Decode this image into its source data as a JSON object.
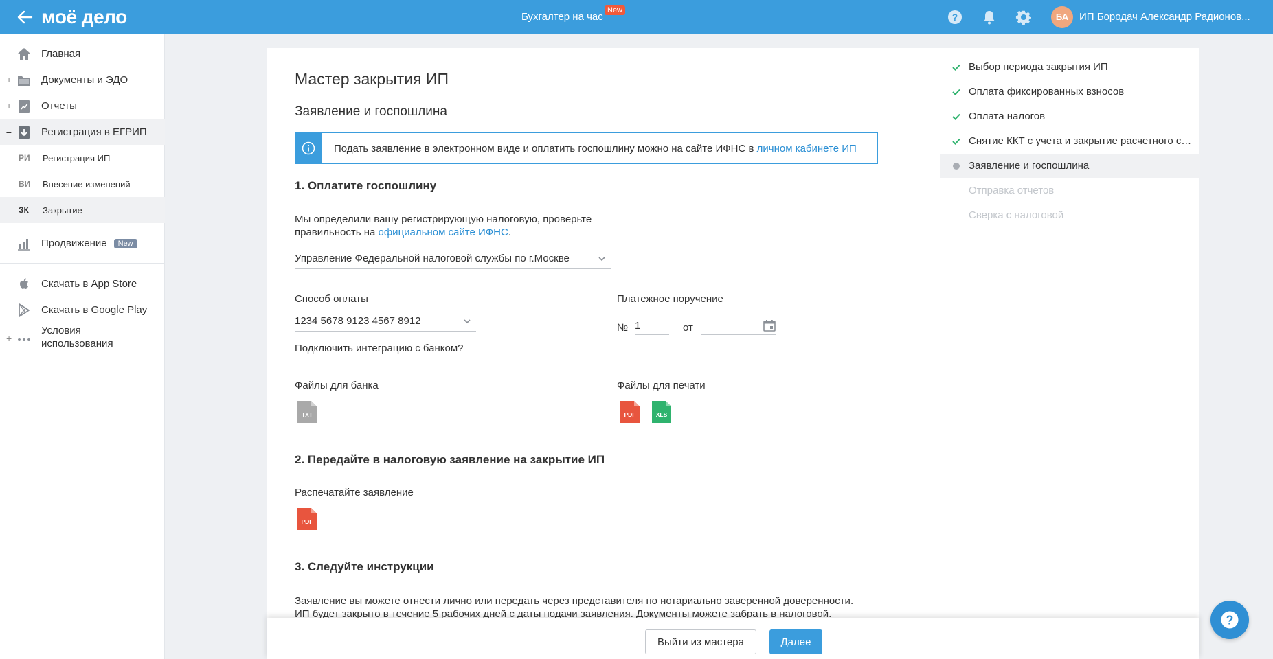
{
  "header": {
    "logo": "моё дело",
    "center_title": "Бухгалтер на час",
    "center_badge": "New",
    "avatar_initials": "БА",
    "user_name": "ИП Бородач Александр Радионов..."
  },
  "sidebar": {
    "items": [
      {
        "label": "Главная",
        "icon": "home-icon"
      },
      {
        "label": "Документы и ЭДО",
        "icon": "folder-icon",
        "prefix": "+"
      },
      {
        "label": "Отчеты",
        "icon": "report-icon",
        "prefix": "+"
      },
      {
        "label": "Регистрация в ЕГРИП",
        "icon": "registration-icon",
        "prefix": "–"
      }
    ],
    "sub_items": [
      {
        "abbr": "РИ",
        "label": "Регистрация ИП"
      },
      {
        "abbr": "ВИ",
        "label": "Внесение изменений"
      },
      {
        "abbr": "ЗК",
        "label": "Закрытие"
      }
    ],
    "promo": {
      "label": "Продвижение",
      "badge": "New"
    },
    "extra": [
      {
        "label": "Скачать в App Store"
      },
      {
        "label": "Скачать в Google Play"
      },
      {
        "label_line1": "Условия",
        "label_line2": "использования",
        "prefix": "+"
      }
    ]
  },
  "main": {
    "title": "Мастер закрытия ИП",
    "subtitle": "Заявление и госпошлина",
    "info_text": "Подать заявление в электронном виде и оплатить госпошлину можно на сайте ИФНС в ",
    "info_link": "личном кабинете ИП",
    "section1": {
      "title": "1. Оплатите госпошлину",
      "desc_line1": "Мы определили вашу регистрирующую налоговую, проверьте",
      "desc_line2_prefix": "правильность на ",
      "desc_link": "официальном сайте ИФНС",
      "desc_line2_suffix": ".",
      "tax_office": "Управление Федеральной налоговой службы по г.Москве",
      "payment_method_label": "Способ оплаты",
      "payment_method_value": "1234 5678 9123 4567 8912",
      "bank_link": "Подключить интеграцию с банком?",
      "payment_order_label": "Платежное поручение",
      "number_sign": "№",
      "number_value": "1",
      "date_from": "от",
      "bank_files_label": "Файлы для банка",
      "print_files_label": "Файлы для печати",
      "file_txt": "TXT",
      "file_pdf": "PDF",
      "file_xls": "XLS"
    },
    "section2": {
      "title": "2. Передайте в налоговую заявление на закрытие ИП",
      "print_label": "Распечатайте заявление",
      "file_pdf": "PDF"
    },
    "section3": {
      "title": "3. Следуйте инструкции",
      "line1": "Заявление вы можете отнести лично или передать через представителя по нотариально заверенной доверенности.",
      "line2": "ИП будет закрыто в течение 5 рабочих дней с даты подачи заявления. Документы можете забрать в налоговой."
    }
  },
  "steps": [
    {
      "label": "Выбор периода закрытия ИП",
      "state": "done"
    },
    {
      "label": "Оплата фиксированных взносов",
      "state": "done"
    },
    {
      "label": "Оплата налогов",
      "state": "done"
    },
    {
      "label": "Снятие ККТ с учета и закрытие расчетного счета",
      "state": "done"
    },
    {
      "label": "Заявление и госпошлина",
      "state": "current"
    },
    {
      "label": "Отправка отчетов",
      "state": "pending"
    },
    {
      "label": "Сверка с налоговой",
      "state": "pending"
    }
  ],
  "footer": {
    "exit_label": "Выйти из мастера",
    "next_label": "Далее"
  },
  "colors": {
    "accent": "#3b9ddd",
    "link": "#2b8fd4",
    "check": "#2fb36e",
    "pdf": "#e8553e",
    "xls": "#2fb36e",
    "txt": "#a9a9a9"
  }
}
